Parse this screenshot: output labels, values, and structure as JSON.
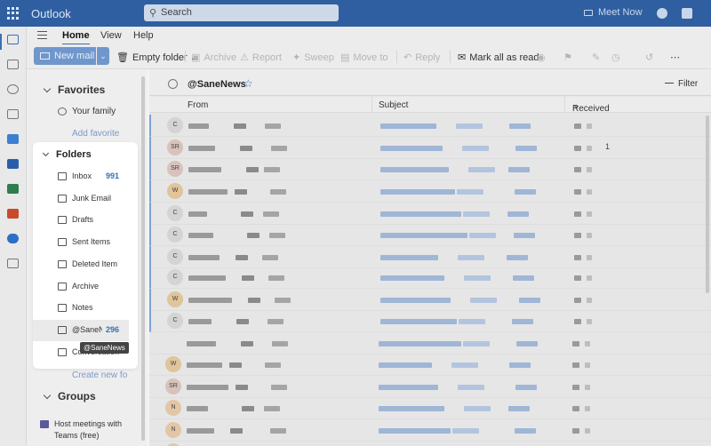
{
  "app": {
    "title": "Outlook"
  },
  "search": {
    "placeholder": "Search"
  },
  "topbar": {
    "meet_now": "Meet Now"
  },
  "tabs": [
    {
      "label": "Home"
    },
    {
      "label": "View"
    },
    {
      "label": "Help"
    }
  ],
  "ribbon": {
    "new_mail": "New mail",
    "empty_folder": "Empty folder",
    "archive": "Archive",
    "report": "Report",
    "sweep": "Sweep",
    "move_to": "Move to",
    "reply": "Reply",
    "mark_all_read": "Mark all as read"
  },
  "favorites": {
    "header": "Favorites",
    "items": [
      {
        "label": "Your family"
      }
    ],
    "add_favorite": "Add favorite"
  },
  "folders": {
    "header": "Folders",
    "items": [
      {
        "label": "Inbox",
        "count": "991"
      },
      {
        "label": "Junk Email"
      },
      {
        "label": "Drafts"
      },
      {
        "label": "Sent Items"
      },
      {
        "label": "Deleted Item"
      },
      {
        "label": "Archive"
      },
      {
        "label": "Notes"
      },
      {
        "label": "@SaneN",
        "count": "296"
      },
      {
        "label": "Conversation"
      }
    ],
    "tooltip": "@SaneNews",
    "create_new": "Create new fo"
  },
  "groups": {
    "header": "Groups",
    "promo_line1": "Host meetings with",
    "promo_line2": "Teams (free)"
  },
  "message_list": {
    "folder_name": "@SaneNews",
    "filter_label": "Filter",
    "columns": {
      "from": "From",
      "subject": "Subject",
      "received": "Received"
    },
    "badge": "1",
    "rows": [
      {
        "avatar": "C",
        "avatar_color": "#d4d4d4"
      },
      {
        "avatar": "SR",
        "avatar_color": "#d8c2bb"
      },
      {
        "avatar": "SR",
        "avatar_color": "#d8c2bb"
      },
      {
        "avatar": "W",
        "avatar_color": "#e0c49a"
      },
      {
        "avatar": "C",
        "avatar_color": "#d4d4d4"
      },
      {
        "avatar": "C",
        "avatar_color": "#d4d4d4"
      },
      {
        "avatar": "C",
        "avatar_color": "#d4d4d4"
      },
      {
        "avatar": "C",
        "avatar_color": "#d4d4d4"
      },
      {
        "avatar": "W",
        "avatar_color": "#e0c49a"
      },
      {
        "avatar": "C",
        "avatar_color": "#d4d4d4"
      },
      {
        "avatar": "",
        "avatar_color": ""
      },
      {
        "avatar": "W",
        "avatar_color": "#e0c49a"
      },
      {
        "avatar": "SR",
        "avatar_color": "#d8c2bb"
      },
      {
        "avatar": "N",
        "avatar_color": "#e3c6a5"
      },
      {
        "avatar": "N",
        "avatar_color": "#e3c6a5"
      },
      {
        "avatar": "N",
        "avatar_color": "#e3c6a5"
      }
    ]
  },
  "colors": {
    "accent": "#3a6fb5",
    "topbar": "#2f5fa0"
  }
}
